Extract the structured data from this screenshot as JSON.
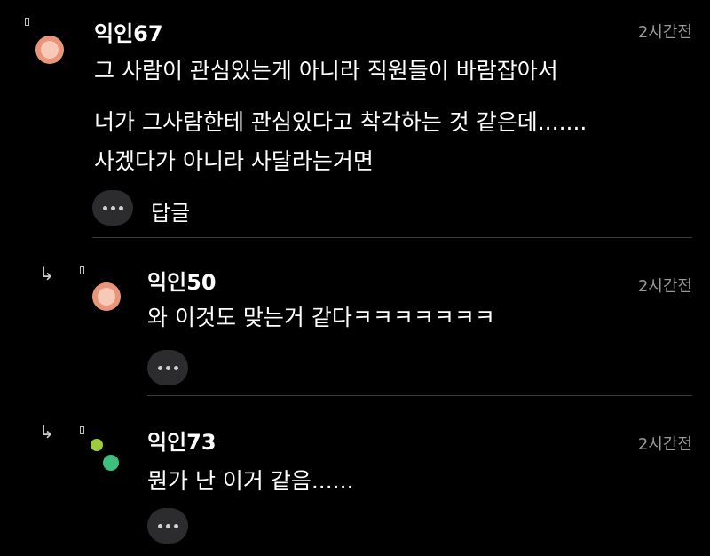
{
  "comments": [
    {
      "author": "익인67",
      "time": "2시간전",
      "lines": [
        "그 사람이 관심있는게 아니라 직원들이 바람잡아서",
        "너가 그사람한테 관심있다고 착각하는 것 같은데.......",
        "사겠다가 아니라 사달라는거면"
      ],
      "reply_label": "답글"
    },
    {
      "author": "익인50",
      "time": "2시간전",
      "lines": [
        "와 이것도 맞는거 같다ㅋㅋㅋㅋㅋㅋㅋ"
      ]
    },
    {
      "author": "익인73",
      "time": "2시간전",
      "lines": [
        "뭔가 난 이거 같음......"
      ]
    }
  ],
  "icons": {
    "more": "ellipsis-icon",
    "reply_arrow": "reply-arrow-icon",
    "marker": "marker-icon"
  },
  "colors": {
    "avatar_orange": "#e8957a",
    "avatar_green_light": "#9ccc3c",
    "avatar_green": "#3fbf7f"
  }
}
